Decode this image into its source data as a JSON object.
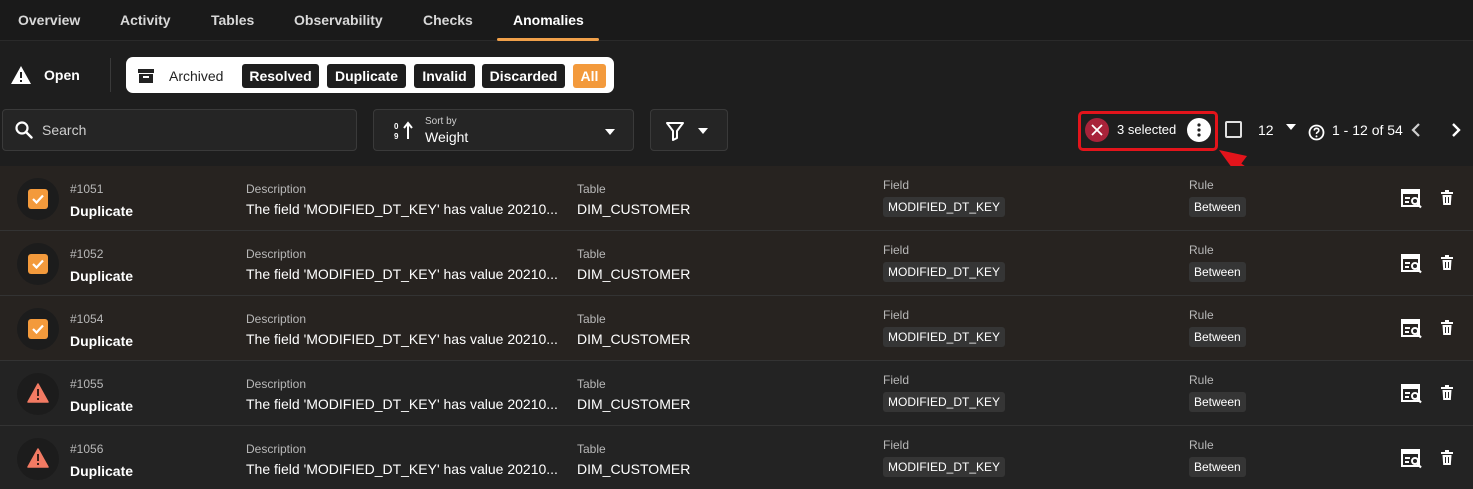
{
  "tabs": [
    {
      "label": "Overview"
    },
    {
      "label": "Activity"
    },
    {
      "label": "Tables"
    },
    {
      "label": "Observability"
    },
    {
      "label": "Checks"
    },
    {
      "label": "Anomalies",
      "active": true
    }
  ],
  "status": {
    "open_label": "Open",
    "archived_label": "Archived",
    "chips": [
      "Resolved",
      "Duplicate",
      "Invalid",
      "Discarded",
      "All"
    ],
    "selected_chip": "All"
  },
  "toolbar": {
    "search_placeholder": "Search",
    "sort_caption": "Sort by",
    "sort_value": "Weight"
  },
  "selection": {
    "selected_text": "3 selected",
    "page_size": "12",
    "range_text": "1 - 12 of 54"
  },
  "columns": {
    "description": "Description",
    "table": "Table",
    "field": "Field",
    "rule": "Rule"
  },
  "rows": [
    {
      "id": "#1051",
      "type": "Duplicate",
      "description": "The field 'MODIFIED_DT_KEY' has value 20210...",
      "table": "DIM_CUSTOMER",
      "field": "MODIFIED_DT_KEY",
      "rule": "Between",
      "checked": true
    },
    {
      "id": "#1052",
      "type": "Duplicate",
      "description": "The field 'MODIFIED_DT_KEY' has value 20210...",
      "table": "DIM_CUSTOMER",
      "field": "MODIFIED_DT_KEY",
      "rule": "Between",
      "checked": true
    },
    {
      "id": "#1054",
      "type": "Duplicate",
      "description": "The field 'MODIFIED_DT_KEY' has value 20210...",
      "table": "DIM_CUSTOMER",
      "field": "MODIFIED_DT_KEY",
      "rule": "Between",
      "checked": true
    },
    {
      "id": "#1055",
      "type": "Duplicate",
      "description": "The field 'MODIFIED_DT_KEY' has value 20210...",
      "table": "DIM_CUSTOMER",
      "field": "MODIFIED_DT_KEY",
      "rule": "Between",
      "checked": false
    },
    {
      "id": "#1056",
      "type": "Duplicate",
      "description": "The field 'MODIFIED_DT_KEY' has value 20210...",
      "table": "DIM_CUSTOMER",
      "field": "MODIFIED_DT_KEY",
      "rule": "Between",
      "checked": false
    }
  ],
  "colors": {
    "accent": "#f39a3c",
    "highlight_box": "#e3141b",
    "warning": "#f27a63"
  },
  "icons": [
    "warning-icon",
    "archive-icon",
    "search-icon",
    "sort-icon",
    "filter-icon",
    "close-icon",
    "more-vertical-icon",
    "help-icon",
    "chevron-left-icon",
    "chevron-right-icon",
    "inspect-icon",
    "trash-icon",
    "checkbox-checked-icon"
  ]
}
